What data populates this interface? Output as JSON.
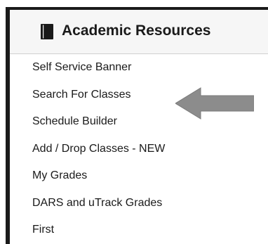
{
  "panel": {
    "title": "Academic Resources",
    "header_icon": "book-icon",
    "colors": {
      "border": "#1a1a1a",
      "header_bg": "#f6f6f6",
      "arrow": "#8c8c8c"
    }
  },
  "links": [
    {
      "label": "Self Service Banner"
    },
    {
      "label": "Search For Classes"
    },
    {
      "label": "Schedule Builder"
    },
    {
      "label": "Add / Drop Classes - NEW"
    },
    {
      "label": "My Grades"
    },
    {
      "label": "DARS and uTrack Grades"
    },
    {
      "label": "First"
    }
  ],
  "annotation": {
    "icon": "arrow-left-icon",
    "points_to": "Search For Classes"
  }
}
